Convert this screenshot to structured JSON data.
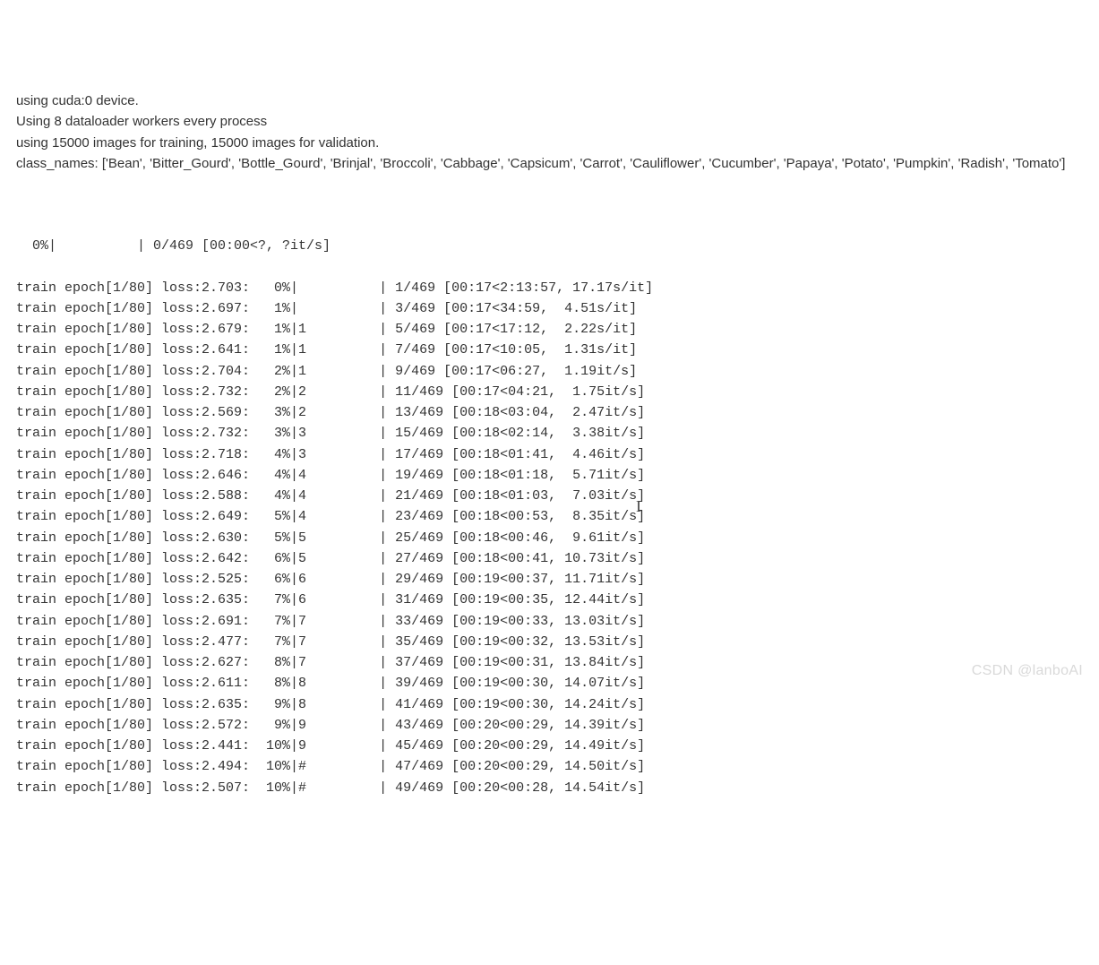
{
  "header": {
    "line1": "using cuda:0 device.",
    "line2": "Using 8 dataloader workers every process",
    "line3": "using 15000 images for training, 15000 images for validation.",
    "line4": "class_names:  ['Bean', 'Bitter_Gourd', 'Bottle_Gourd', 'Brinjal', 'Broccoli', 'Cabbage', 'Capsicum', 'Carrot', 'Cauliflower', 'Cucumber', 'Papaya', 'Potato', 'Pumpkin', 'Radish', 'Tomato']"
  },
  "initial_progress": "  0%|          | 0/469 [00:00<?, ?it/s]",
  "rows": [
    {
      "text": "train epoch[1/80] loss:2.703:   0%|          | 1/469 [00:17<2:13:57, 17.17s/it]"
    },
    {
      "text": "train epoch[1/80] loss:2.697:   1%|          | 3/469 [00:17<34:59,  4.51s/it]"
    },
    {
      "text": "train epoch[1/80] loss:2.679:   1%|1         | 5/469 [00:17<17:12,  2.22s/it]"
    },
    {
      "text": "train epoch[1/80] loss:2.641:   1%|1         | 7/469 [00:17<10:05,  1.31s/it]"
    },
    {
      "text": "train epoch[1/80] loss:2.704:   2%|1         | 9/469 [00:17<06:27,  1.19it/s]"
    },
    {
      "text": "train epoch[1/80] loss:2.732:   2%|2         | 11/469 [00:17<04:21,  1.75it/s]"
    },
    {
      "text": "train epoch[1/80] loss:2.569:   3%|2         | 13/469 [00:18<03:04,  2.47it/s]"
    },
    {
      "text": "train epoch[1/80] loss:2.732:   3%|3         | 15/469 [00:18<02:14,  3.38it/s]"
    },
    {
      "text": "train epoch[1/80] loss:2.718:   4%|3         | 17/469 [00:18<01:41,  4.46it/s]"
    },
    {
      "text": "train epoch[1/80] loss:2.646:   4%|4         | 19/469 [00:18<01:18,  5.71it/s]"
    },
    {
      "text": "train epoch[1/80] loss:2.588:   4%|4         | 21/469 [00:18<01:03,  7.03it/s]"
    },
    {
      "text": "train epoch[1/80] loss:2.649:   5%|4         | 23/469 [00:18<00:53,  8.35it/s]"
    },
    {
      "text": "train epoch[1/80] loss:2.630:   5%|5         | 25/469 [00:18<00:46,  9.61it/s]"
    },
    {
      "text": "train epoch[1/80] loss:2.642:   6%|5         | 27/469 [00:18<00:41, 10.73it/s]"
    },
    {
      "text": "train epoch[1/80] loss:2.525:   6%|6         | 29/469 [00:19<00:37, 11.71it/s]"
    },
    {
      "text": "train epoch[1/80] loss:2.635:   7%|6         | 31/469 [00:19<00:35, 12.44it/s]"
    },
    {
      "text": "train epoch[1/80] loss:2.691:   7%|7         | 33/469 [00:19<00:33, 13.03it/s]"
    },
    {
      "text": "train epoch[1/80] loss:2.477:   7%|7         | 35/469 [00:19<00:32, 13.53it/s]"
    },
    {
      "text": "train epoch[1/80] loss:2.627:   8%|7         | 37/469 [00:19<00:31, 13.84it/s]"
    },
    {
      "text": "train epoch[1/80] loss:2.611:   8%|8         | 39/469 [00:19<00:30, 14.07it/s]"
    },
    {
      "text": "train epoch[1/80] loss:2.635:   9%|8         | 41/469 [00:19<00:30, 14.24it/s]"
    },
    {
      "text": "train epoch[1/80] loss:2.572:   9%|9         | 43/469 [00:20<00:29, 14.39it/s]"
    },
    {
      "text": "train epoch[1/80] loss:2.441:  10%|9         | 45/469 [00:20<00:29, 14.49it/s]"
    },
    {
      "text": "train epoch[1/80] loss:2.494:  10%|#         | 47/469 [00:20<00:29, 14.50it/s]"
    },
    {
      "text": "train epoch[1/80] loss:2.507:  10%|#         | 49/469 [00:20<00:28, 14.54it/s]"
    }
  ],
  "watermark": "CSDN @lanboAI"
}
